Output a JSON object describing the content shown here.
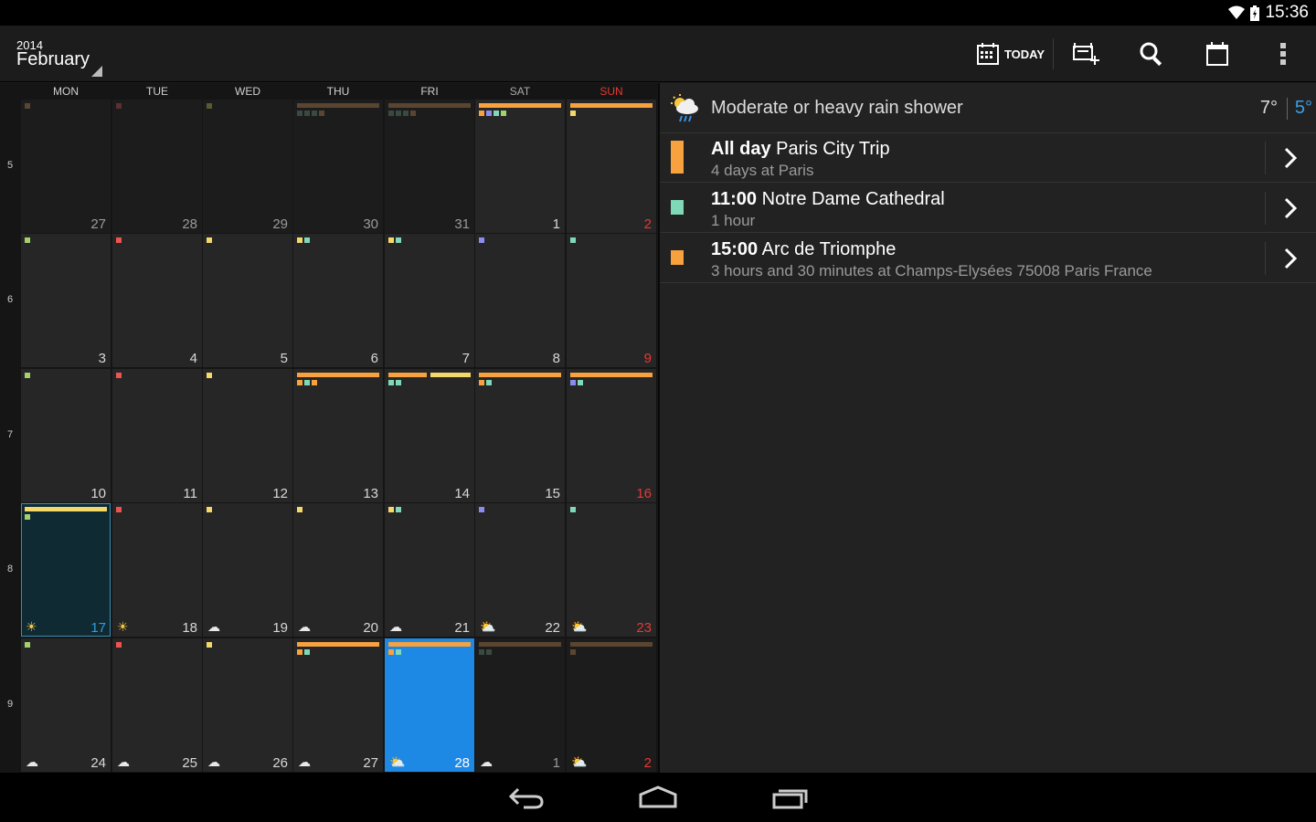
{
  "status": {
    "time": "15:36"
  },
  "header": {
    "year": "2014",
    "month": "February",
    "today_label": "TODAY"
  },
  "colors": {
    "orange": "#f7a23e",
    "yellow": "#f5d86a",
    "brown": "#5a4630",
    "teal": "#7fd8b8",
    "red": "#ef5350",
    "green": "#a5d16b",
    "purple": "#8c8cf0",
    "today_blue": "#1e88e5",
    "sunday_red": "#e53935"
  },
  "calendar": {
    "day_headers": [
      "MON",
      "TUE",
      "WED",
      "THU",
      "FRI",
      "SAT",
      "SUN"
    ],
    "week_numbers": [
      "5",
      "6",
      "7",
      "8",
      "9"
    ],
    "weeks": [
      [
        {
          "d": "27",
          "other": true,
          "bar": null,
          "dots": [
            "#5a4630"
          ]
        },
        {
          "d": "28",
          "other": true,
          "bar": null,
          "dots": [
            "#5a3030"
          ]
        },
        {
          "d": "29",
          "other": true,
          "bar": null,
          "dots": [
            "#5a5a30"
          ]
        },
        {
          "d": "30",
          "other": true,
          "bar": "#5a4630",
          "dots": [
            "#3a4a40",
            "#3a4a40",
            "#3a4a40",
            "#5a4630"
          ]
        },
        {
          "d": "31",
          "other": true,
          "bar": "#5a4630",
          "dots": [
            "#3a4a40",
            "#3a4a40",
            "#3a4a40",
            "#5a4630"
          ]
        },
        {
          "d": "1",
          "other": false,
          "bar": "#f7a23e",
          "dots": [
            "#f7a23e",
            "#8c8cf0",
            "#7fd8b8",
            "#a5d16b"
          ]
        },
        {
          "d": "2",
          "other": false,
          "sun": true,
          "bar": "#f7a23e",
          "dots": [
            "#f5d86a"
          ]
        }
      ],
      [
        {
          "d": "3",
          "dots": [
            "#a5d16b"
          ]
        },
        {
          "d": "4",
          "dots": [
            "#ef5350"
          ]
        },
        {
          "d": "5",
          "dots": [
            "#f5d86a"
          ]
        },
        {
          "d": "6",
          "dots": [
            "#f5d86a",
            "#7fd8b8"
          ]
        },
        {
          "d": "7",
          "dots": [
            "#f5d86a",
            "#7fd8b8"
          ]
        },
        {
          "d": "8",
          "dots": [
            "#8c8cf0"
          ]
        },
        {
          "d": "9",
          "sun": true,
          "dots": [
            "#7fd8b8"
          ]
        }
      ],
      [
        {
          "d": "10",
          "dots": [
            "#a5d16b"
          ]
        },
        {
          "d": "11",
          "dots": [
            "#ef5350"
          ]
        },
        {
          "d": "12",
          "dots": [
            "#f5d86a"
          ]
        },
        {
          "d": "13",
          "bar": "#f7a23e",
          "dots": [
            "#f7a23e",
            "#7fd8b8",
            "#f7a23e"
          ]
        },
        {
          "d": "14",
          "bar2": [
            "#f7a23e",
            "#f5d86a"
          ],
          "dots": [
            "#7fd8b8",
            "#7fd8b8"
          ]
        },
        {
          "d": "15",
          "bar": "#f7a23e",
          "dots": [
            "#f7a23e",
            "#7fd8b8"
          ]
        },
        {
          "d": "16",
          "sun": true,
          "bar": "#f7a23e",
          "dots": [
            "#8c8cf0",
            "#7fd8b8"
          ]
        }
      ],
      [
        {
          "d": "17",
          "today": true,
          "bar": "#f5d86a",
          "dots": [
            "#a5d16b"
          ],
          "wx": "☀",
          "wxc": "#f5c842"
        },
        {
          "d": "18",
          "dots": [
            "#ef5350"
          ],
          "wx": "☀",
          "wxc": "#f5c842"
        },
        {
          "d": "19",
          "dots": [
            "#f5d86a"
          ],
          "wx": "☁",
          "wxc": "#e8e8e8"
        },
        {
          "d": "20",
          "dots": [
            "#f5d86a"
          ],
          "wx": "☁",
          "wxc": "#e8e8e8"
        },
        {
          "d": "21",
          "dots": [
            "#f5d86a",
            "#7fd8b8"
          ],
          "wx": "☁",
          "wxc": "#e8e8e8"
        },
        {
          "d": "22",
          "dots": [
            "#8c8cf0"
          ],
          "wx": "⛅",
          "wxc": "#f5c842"
        },
        {
          "d": "23",
          "sun": true,
          "dots": [
            "#7fd8b8"
          ],
          "wx": "⛅",
          "wxc": "#f5c842"
        }
      ],
      [
        {
          "d": "24",
          "dots": [
            "#a5d16b"
          ],
          "wx": "☁",
          "wxc": "#e8e8e8"
        },
        {
          "d": "25",
          "dots": [
            "#ef5350"
          ],
          "wx": "☁",
          "wxc": "#e8e8e8"
        },
        {
          "d": "26",
          "dots": [
            "#f5d86a"
          ],
          "wx": "☁",
          "wxc": "#e8e8e8"
        },
        {
          "d": "27",
          "bar": "#f7a23e",
          "dots": [
            "#f7a23e",
            "#7fd8b8"
          ],
          "wx": "☁",
          "wxc": "#e8e8e8"
        },
        {
          "d": "28",
          "selected": true,
          "bar": "#f7a23e",
          "dots": [
            "#f7a23e",
            "#7fd8b8"
          ],
          "wx": "⛅",
          "wxc": "#f5c842"
        },
        {
          "d": "1",
          "other": true,
          "bar": "#5a4630",
          "dots": [
            "#3a4a40",
            "#3a4a40"
          ],
          "wx": "☁",
          "wxc": "#e8e8e8"
        },
        {
          "d": "2",
          "other": true,
          "sun": true,
          "bar": "#5a4630",
          "dots": [
            "#5a4630"
          ],
          "wx": "⛅",
          "wxc": "#f5c842"
        }
      ]
    ]
  },
  "agenda": {
    "weather": {
      "description": "Moderate or heavy rain shower",
      "high": "7°",
      "low": "5°"
    },
    "events": [
      {
        "time": "All day",
        "title": "Paris City Trip",
        "subtitle": "4 days at Paris",
        "color": "#f7a23e"
      },
      {
        "time": "11:00",
        "title": "Notre Dame Cathedral",
        "subtitle": "1 hour",
        "color": "#7fd8b8"
      },
      {
        "time": "15:00",
        "title": "Arc de Triomphe",
        "subtitle": "3 hours and 30 minutes at Champs-Elysées 75008 Paris France",
        "color": "#f7a23e"
      }
    ]
  }
}
